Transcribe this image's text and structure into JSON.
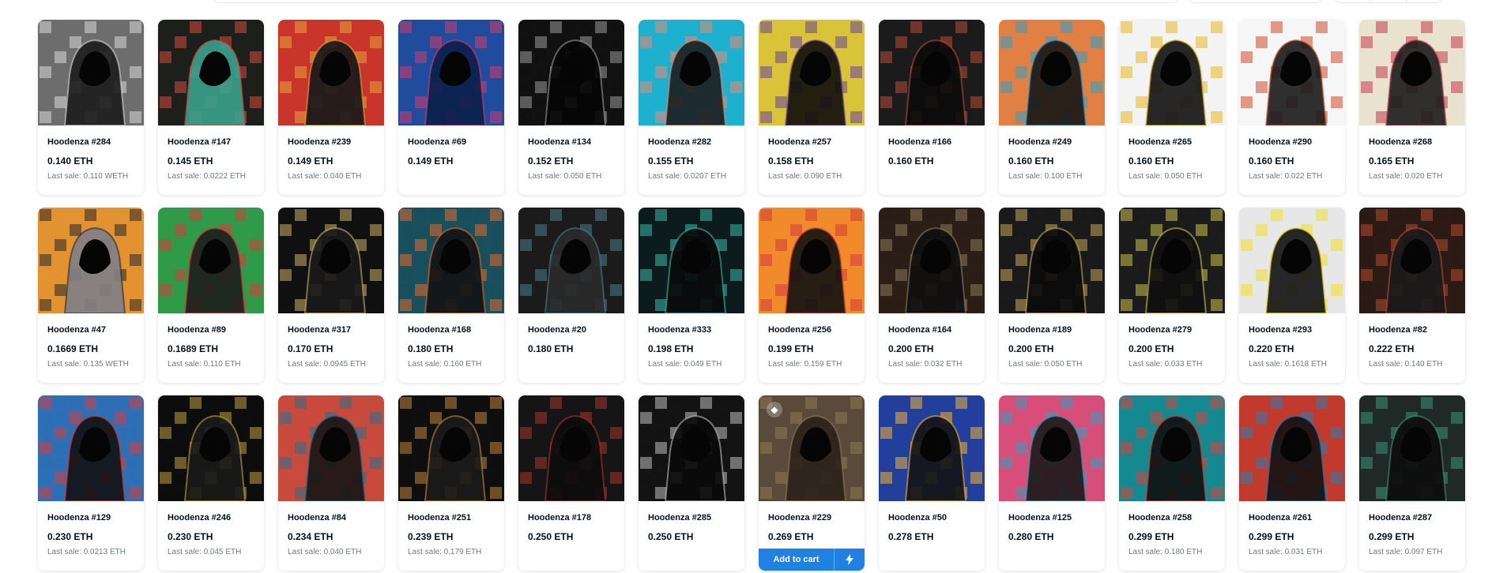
{
  "items": [
    {
      "name": "Hoodenza #284",
      "price": "0.140 ETH",
      "last_sale": "Last sale: 0.110 WETH",
      "colors": [
        "#6d6d6d",
        "#d8d8d8",
        "#1c1c1c"
      ]
    },
    {
      "name": "Hoodenza #147",
      "price": "0.145 ETH",
      "last_sale": "Last sale: 0.0222 ETH",
      "colors": [
        "#1d1f1c",
        "#d24b3e",
        "#3aa28d"
      ]
    },
    {
      "name": "Hoodenza #239",
      "price": "0.149 ETH",
      "last_sale": "Last sale: 0.040 ETH",
      "colors": [
        "#c9352b",
        "#e4a33b",
        "#16181a"
      ]
    },
    {
      "name": "Hoodenza #69",
      "price": "0.149 ETH",
      "last_sale": "",
      "colors": [
        "#1f4c9c",
        "#d63c6f",
        "#0b1f4a"
      ]
    },
    {
      "name": "Hoodenza #134",
      "price": "0.152 ETH",
      "last_sale": "Last sale: 0.050 ETH",
      "colors": [
        "#111111",
        "#9a9a9a",
        "#050505"
      ]
    },
    {
      "name": "Hoodenza #282",
      "price": "0.155 ETH",
      "last_sale": "Last sale: 0.0207 ETH",
      "colors": [
        "#1db0cf",
        "#e98b74",
        "#1d1d1d"
      ]
    },
    {
      "name": "Hoodenza #257",
      "price": "0.158 ETH",
      "last_sale": "Last sale: 0.090 ETH",
      "colors": [
        "#d9c337",
        "#6a3fa0",
        "#0d0d0d"
      ]
    },
    {
      "name": "Hoodenza #166",
      "price": "0.160 ETH",
      "last_sale": "",
      "colors": [
        "#1b1b1b",
        "#b64d38",
        "#0b0b0b"
      ]
    },
    {
      "name": "Hoodenza #249",
      "price": "0.160 ETH",
      "last_sale": "Last sale: 0.100 ETH",
      "colors": [
        "#e28043",
        "#2f9ec8",
        "#161616"
      ]
    },
    {
      "name": "Hoodenza #265",
      "price": "0.160 ETH",
      "last_sale": "Last sale: 0.050 ETH",
      "colors": [
        "#f3f3f3",
        "#e5b823",
        "#111111"
      ]
    },
    {
      "name": "Hoodenza #290",
      "price": "0.160 ETH",
      "last_sale": "Last sale: 0.022 ETH",
      "colors": [
        "#f6f6f6",
        "#d14a2b",
        "#1a1a1a"
      ]
    },
    {
      "name": "Hoodenza #268",
      "price": "0.165 ETH",
      "last_sale": "Last sale: 0.020 ETH",
      "colors": [
        "#e8e2cf",
        "#c43a4a",
        "#1c1c1c"
      ]
    },
    {
      "name": "Hoodenza #47",
      "price": "0.1669 ETH",
      "last_sale": "Last sale: 0.135 WETH",
      "colors": [
        "#e29230",
        "#27272b",
        "#7f7f88"
      ]
    },
    {
      "name": "Hoodenza #89",
      "price": "0.1689 ETH",
      "last_sale": "Last sale: 0.110 ETH",
      "colors": [
        "#2f9a48",
        "#d83c3c",
        "#1d1d1d"
      ]
    },
    {
      "name": "Hoodenza #317",
      "price": "0.170 ETH",
      "last_sale": "Last sale: 0.0945 ETH",
      "colors": [
        "#101010",
        "#c9b069",
        "#1a1a1a"
      ]
    },
    {
      "name": "Hoodenza #168",
      "price": "0.180 ETH",
      "last_sale": "Last sale: 0.160 ETH",
      "colors": [
        "#1a4f5c",
        "#e26b2c",
        "#131313"
      ]
    },
    {
      "name": "Hoodenza #20",
      "price": "0.180 ETH",
      "last_sale": "",
      "colors": [
        "#1b1b1b",
        "#4b7c86",
        "#2a2a2a"
      ]
    },
    {
      "name": "Hoodenza #333",
      "price": "0.198 ETH",
      "last_sale": "Last sale: 0.049 ETH",
      "colors": [
        "#0d1b1e",
        "#39b8a6",
        "#0a0a0a"
      ]
    },
    {
      "name": "Hoodenza #256",
      "price": "0.199 ETH",
      "last_sale": "Last sale: 0.159 ETH",
      "colors": [
        "#f08a2b",
        "#d33b3b",
        "#111111"
      ]
    },
    {
      "name": "Hoodenza #164",
      "price": "0.200 ETH",
      "last_sale": "Last sale: 0.032 ETH",
      "colors": [
        "#2a1e15",
        "#8a7a5d",
        "#0e0e0e"
      ]
    },
    {
      "name": "Hoodenza #189",
      "price": "0.200 ETH",
      "last_sale": "Last sale: 0.050 ETH",
      "colors": [
        "#1a1a1a",
        "#c7a65e",
        "#0b0b0b"
      ]
    },
    {
      "name": "Hoodenza #279",
      "price": "0.200 ETH",
      "last_sale": "Last sale: 0.033 ETH",
      "colors": [
        "#1c1c1c",
        "#c8c24b",
        "#0f0f0f"
      ]
    },
    {
      "name": "Hoodenza #293",
      "price": "0.220 ETH",
      "last_sale": "Last sale: 0.1618 ETH",
      "colors": [
        "#e7e7e7",
        "#f1e024",
        "#111111"
      ]
    },
    {
      "name": "Hoodenza #82",
      "price": "0.222 ETH",
      "last_sale": "Last sale: 0.140 ETH",
      "colors": [
        "#2c1a14",
        "#b54a2e",
        "#1a1a1a"
      ]
    },
    {
      "name": "Hoodenza #129",
      "price": "0.230 ETH",
      "last_sale": "Last sale: 0.0213 ETH",
      "colors": [
        "#2e6fb5",
        "#d93d3d",
        "#111111"
      ]
    },
    {
      "name": "Hoodenza #246",
      "price": "0.230 ETH",
      "last_sale": "Last sale: 0.045 ETH",
      "colors": [
        "#0d0d0d",
        "#c0a040",
        "#1a1a1a"
      ]
    },
    {
      "name": "Hoodenza #84",
      "price": "0.234 ETH",
      "last_sale": "Last sale: 0.040 ETH",
      "colors": [
        "#c84a3c",
        "#2b6f8e",
        "#151515"
      ]
    },
    {
      "name": "Hoodenza #251",
      "price": "0.239 ETH",
      "last_sale": "Last sale: 0.179 ETH",
      "colors": [
        "#0f0f0f",
        "#c0863a",
        "#1b1b1b"
      ]
    },
    {
      "name": "Hoodenza #178",
      "price": "0.250 ETH",
      "last_sale": "",
      "colors": [
        "#151515",
        "#a3342f",
        "#0c0c0c"
      ]
    },
    {
      "name": "Hoodenza #285",
      "price": "0.250 ETH",
      "last_sale": "",
      "colors": [
        "#131313",
        "#bdbdbd",
        "#0a0a0a"
      ]
    },
    {
      "name": "Hoodenza #229",
      "price": "0.269 ETH",
      "last_sale": "",
      "colors": [
        "#5a4a3a",
        "#8f7a52",
        "#2a2119"
      ]
    },
    {
      "name": "Hoodenza #50",
      "price": "0.278 ETH",
      "last_sale": "",
      "colors": [
        "#233f9b",
        "#f0b23a",
        "#141414"
      ]
    },
    {
      "name": "Hoodenza #125",
      "price": "0.280 ETH",
      "last_sale": "",
      "colors": [
        "#d84e7a",
        "#3a9bb6",
        "#1a1a1a"
      ]
    },
    {
      "name": "Hoodenza #258",
      "price": "0.299 ETH",
      "last_sale": "Last sale: 0.180 ETH",
      "colors": [
        "#14898f",
        "#d7413c",
        "#101010"
      ]
    },
    {
      "name": "Hoodenza #261",
      "price": "0.299 ETH",
      "last_sale": "Last sale: 0.031 ETH",
      "colors": [
        "#c23a2c",
        "#2f7bb0",
        "#121212"
      ]
    },
    {
      "name": "Hoodenza #287",
      "price": "0.299 ETH",
      "last_sale": "Last sale: 0.097 ETH",
      "colors": [
        "#1f2a26",
        "#3e8f78",
        "#0c0c0c"
      ]
    }
  ],
  "hovered_card": {
    "index": 30,
    "badge_icon": "ethereum-icon",
    "add_to_cart_label": "Add to cart",
    "buy_now_icon": "lightning-icon",
    "accent": "#2081e2"
  }
}
